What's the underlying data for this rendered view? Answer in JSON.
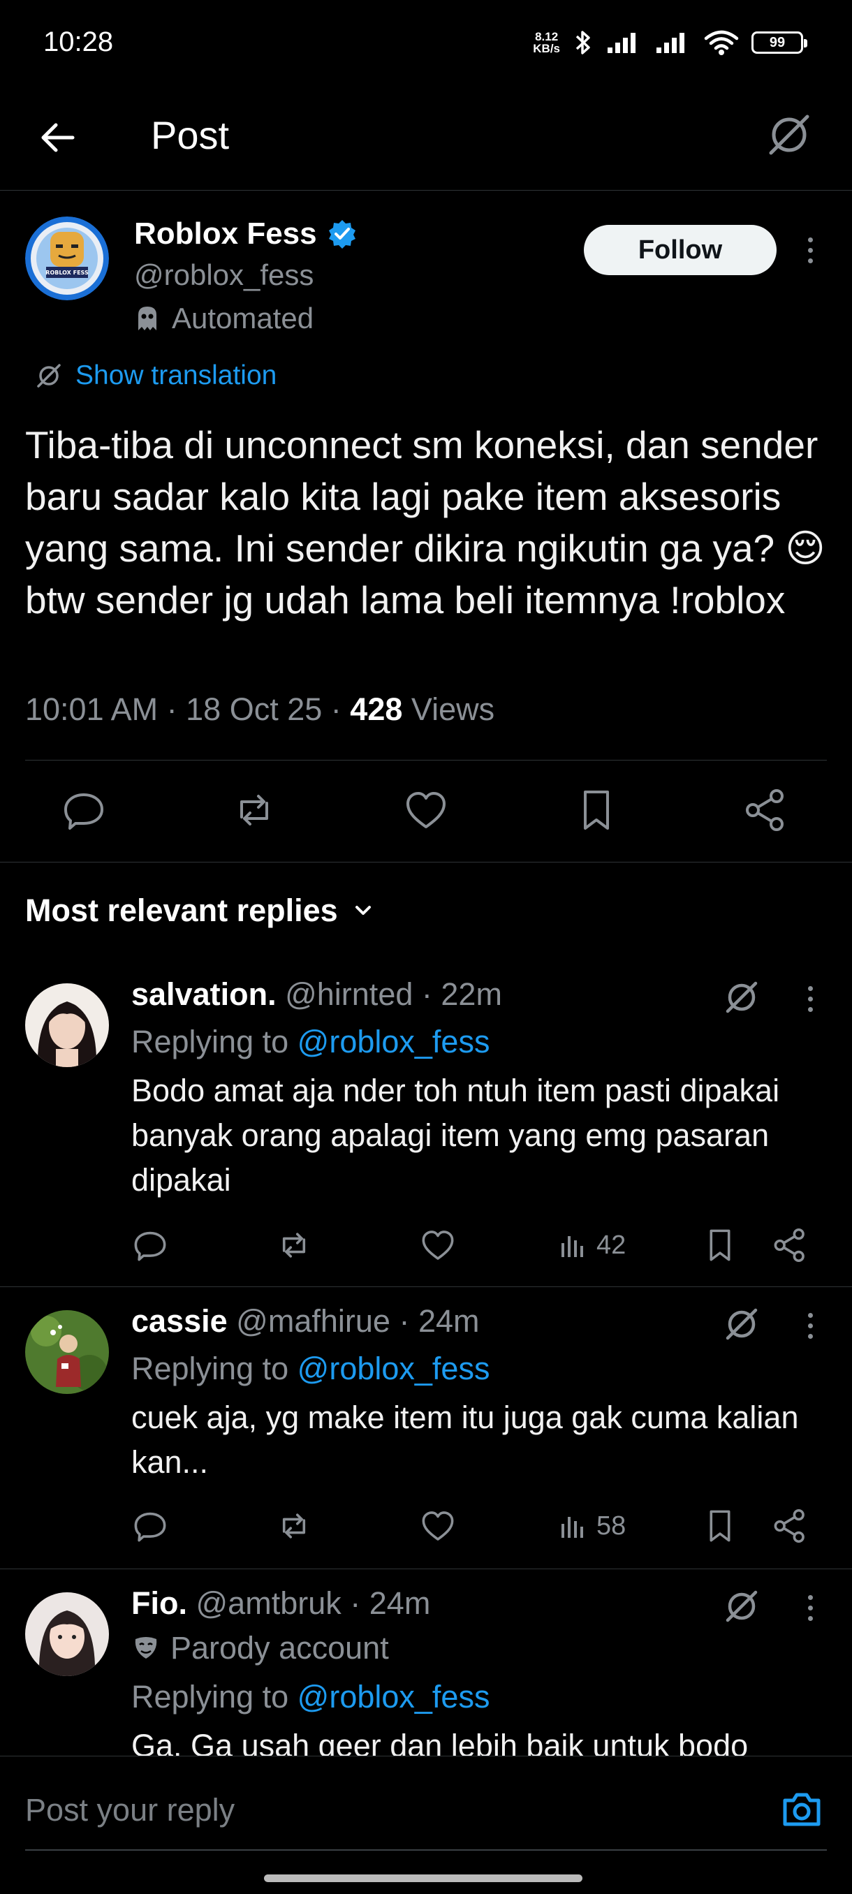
{
  "status_bar": {
    "time": "10:28",
    "net_speed_value": "8.12",
    "net_speed_unit": "KB/s",
    "battery": "99"
  },
  "header": {
    "title": "Post"
  },
  "post": {
    "author_name": "Roblox Fess",
    "author_handle": "@roblox_fess",
    "automated_label": "Automated",
    "follow_label": "Follow",
    "avatar_text": "ROBLOX FESS",
    "show_translation": "Show translation",
    "text": "Tiba-tiba di unconnect sm koneksi, dan sender baru sadar kalo kita lagi pake item aksesoris yang sama. Ini sender dikira ngikutin ga ya? 😌 btw sender jg udah lama beli itemnya !roblox",
    "time": "10:01 AM",
    "date": "18 Oct 25",
    "views_count": "428",
    "views_label": "Views"
  },
  "replies_section": {
    "sort_label": "Most relevant replies"
  },
  "replies": [
    {
      "name": "salvation.",
      "handle": "@hirnted",
      "time": "22m",
      "replying_label": "Replying to",
      "replying_to": "@roblox_fess",
      "text": "Bodo amat aja nder toh ntuh item pasti dipakai banyak orang apalagi item yang emg pasaran dipakai",
      "views": "42"
    },
    {
      "name": "cassie",
      "handle": "@mafhirue",
      "time": "24m",
      "replying_label": "Replying to",
      "replying_to": "@roblox_fess",
      "text": "cuek aja, yg make item itu juga gak cuma kalian kan...",
      "views": "58"
    },
    {
      "name": "Fio.",
      "handle": "@amtbruk",
      "time": "24m",
      "badge": "Parody account",
      "replying_label": "Replying to",
      "replying_to": "@roblox_fess",
      "text": "Ga. Ga usah geer dan lebih baik untuk bodo"
    }
  ],
  "compose": {
    "placeholder": "Post your reply"
  },
  "colors": {
    "background": "#000000",
    "accent": "#1d9bf0",
    "muted_text": "#8b9096",
    "divider": "#2f3336"
  }
}
